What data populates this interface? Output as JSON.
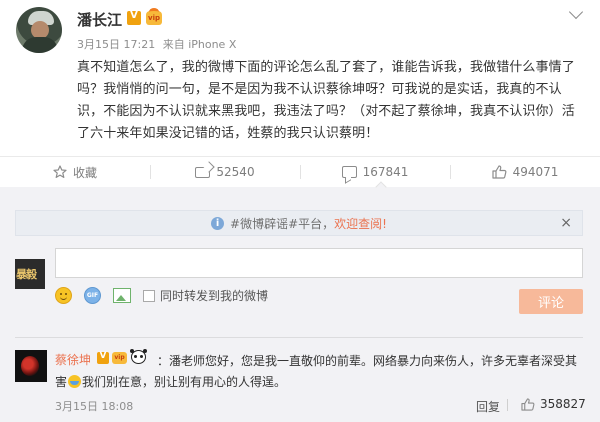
{
  "post": {
    "author": "潘长江",
    "date": "3月15日 17:21",
    "source": "来自 iPhone X",
    "text": "真不知道怎么了，我的微博下面的评论怎么乱了套了，谁能告诉我，我做错什么事情了吗？我悄悄的问一句，是不是因为我不认识蔡徐坤呀？可我说的是实话，我真的不认识，不能因为不认识就来黑我吧，我违法了吗？（对不起了蔡徐坤，我真不认识你）活了六十来年如果没记错的话，姓蔡的我只认识蔡明！"
  },
  "actions": {
    "favorite_label": "收藏",
    "repost_count": "52540",
    "comment_count": "167841",
    "like_count": "494071"
  },
  "comment_box": {
    "notice_prefix": "#微博辟谣#平台，",
    "notice_link": "欢迎查阅!",
    "notice_close": "×",
    "my_avatar_text": "暴毅",
    "input_value": "",
    "repost_checkbox_label": "同时转发到我的微博",
    "submit_label": "评论"
  },
  "comments": [
    {
      "author": "蔡徐坤",
      "text_part1": "：潘老师您好，您是我一直敬仰的前辈。网络暴力向来伤人，许多无辜者深受其害",
      "text_part2": "我们别在意，别让别有用心的人得逞。",
      "time": "3月15日 18:08",
      "reply_label": "回复",
      "like_count": "358827"
    }
  ],
  "colors": {
    "accent": "#eb7350",
    "submit_disabled": "#f7b99a",
    "panel_bg": "#f2f2f5",
    "vip_gold": "#f0a20f"
  },
  "icons": [
    "gear-icon",
    "chevron-down-icon",
    "star-icon",
    "repost-icon",
    "comment-icon",
    "thumbs-up-icon",
    "info-icon",
    "smile-icon",
    "gif-icon",
    "image-icon"
  ]
}
